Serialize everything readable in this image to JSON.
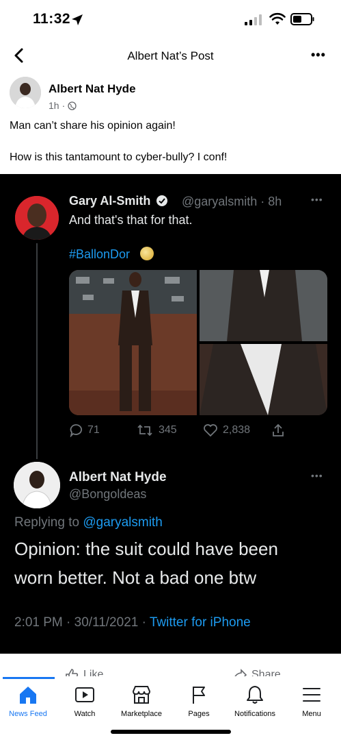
{
  "status_bar": {
    "time": "11:32"
  },
  "header": {
    "title": "Albert Nat’s Post"
  },
  "post": {
    "author": "Albert Nat Hyde",
    "time": "1h",
    "text_line1": "Man can’t share his opinion again!",
    "text_line2": "How is this tantamount to cyber-bully? I conf!"
  },
  "tweet1": {
    "name": "Gary Al-Smith",
    "handle": "@garyalsmith · 8h",
    "text": "And that's that for that.",
    "hashtag": "#BallonDor",
    "replies": "71",
    "retweets": "345",
    "likes": "2,838"
  },
  "tweet2": {
    "name": "Albert Nat Hyde",
    "handle": "@Bongoldeas",
    "replying_prefix": "Replying to ",
    "replying_to": "@garyalsmith",
    "text_line1": "Opinion: the suit could have been",
    "text_line2": "worn better. Not a bad one btw",
    "timestamp": "2:01 PM · 30/11/2021 · ",
    "source": "Twitter for iPhone"
  },
  "actions": {
    "like": "Like",
    "share": "Share"
  },
  "nav": {
    "items": [
      {
        "label": "News Feed",
        "icon": "home-icon",
        "active": true
      },
      {
        "label": "Watch",
        "icon": "watch-icon"
      },
      {
        "label": "Marketplace",
        "icon": "marketplace-icon"
      },
      {
        "label": "Pages",
        "icon": "flag-icon"
      },
      {
        "label": "Notifications",
        "icon": "bell-icon"
      },
      {
        "label": "Menu",
        "icon": "menu-icon"
      }
    ]
  },
  "colors": {
    "accent": "#1877f2",
    "twitter_blue": "#1d9bf0",
    "tweet_bg": "#000000"
  }
}
